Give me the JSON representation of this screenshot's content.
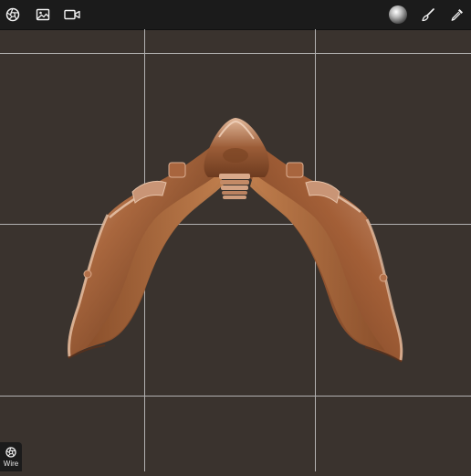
{
  "toolbar": {
    "left_tools": [
      {
        "icon": "aperture-icon",
        "name": "tool-aperture"
      },
      {
        "icon": "image-icon",
        "name": "tool-image"
      },
      {
        "icon": "video-camera-icon",
        "name": "tool-video"
      }
    ],
    "right_tools": [
      {
        "icon": "material-sphere-icon",
        "name": "tool-material"
      },
      {
        "icon": "paint-brush-icon",
        "name": "tool-brush"
      },
      {
        "icon": "eyedropper-icon",
        "name": "tool-eyedropper"
      }
    ]
  },
  "viewport": {
    "background_color": "#3a332e",
    "grid_color": "#c8c8c8",
    "model": {
      "name": "helmet-mesh",
      "base_color": "#a0603a"
    }
  },
  "wire_button": {
    "label": "Wire",
    "icon": "aperture-icon"
  }
}
